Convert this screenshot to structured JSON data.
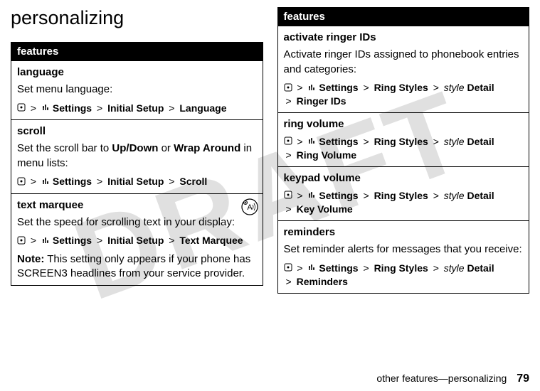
{
  "watermark": "DRAFT",
  "title": "personalizing",
  "header": "features",
  "footer": {
    "text": "other features—personalizing",
    "page": "79"
  },
  "left": {
    "language": {
      "name": "language",
      "desc": "Set menu language:",
      "seg1": "Settings",
      "seg2": "Initial Setup",
      "seg3": "Language"
    },
    "scroll": {
      "name": "scroll",
      "desc_pre": "Set the scroll bar to ",
      "desc_b1": "Up/Down",
      "desc_mid": " or ",
      "desc_b2": "Wrap Around",
      "desc_post": " in menu lists:",
      "seg1": "Settings",
      "seg2": "Initial Setup",
      "seg3": "Scroll"
    },
    "marquee": {
      "name": "text marquee",
      "desc": "Set the speed for scrolling text in your display:",
      "seg1": "Settings",
      "seg2": "Initial Setup",
      "seg3": "Text Marquee",
      "note_label": "Note:",
      "note": " This setting only appears if your phone has SCREEN3 headlines from your service provider."
    }
  },
  "right": {
    "activate": {
      "name": "activate ringer IDs",
      "desc": "Activate ringer IDs assigned to phonebook entries and categories:",
      "seg1": "Settings",
      "seg2": "Ring Styles",
      "seg3": "style",
      "seg3b": "Detail",
      "seg4": "Ringer IDs"
    },
    "ringvol": {
      "name": "ring volume",
      "seg1": "Settings",
      "seg2": "Ring Styles",
      "seg3": "style",
      "seg3b": "Detail",
      "seg4": "Ring Volume"
    },
    "keyvol": {
      "name": "keypad volume",
      "seg1": "Settings",
      "seg2": "Ring Styles",
      "seg3": "style",
      "seg3b": "Detail",
      "seg4": "Key Volume"
    },
    "reminders": {
      "name": "reminders",
      "desc": "Set reminder alerts for messages that you receive:",
      "seg1": "Settings",
      "seg2": "Ring Styles",
      "seg3": "style",
      "seg3b": "Detail",
      "seg4": "Reminders"
    }
  }
}
